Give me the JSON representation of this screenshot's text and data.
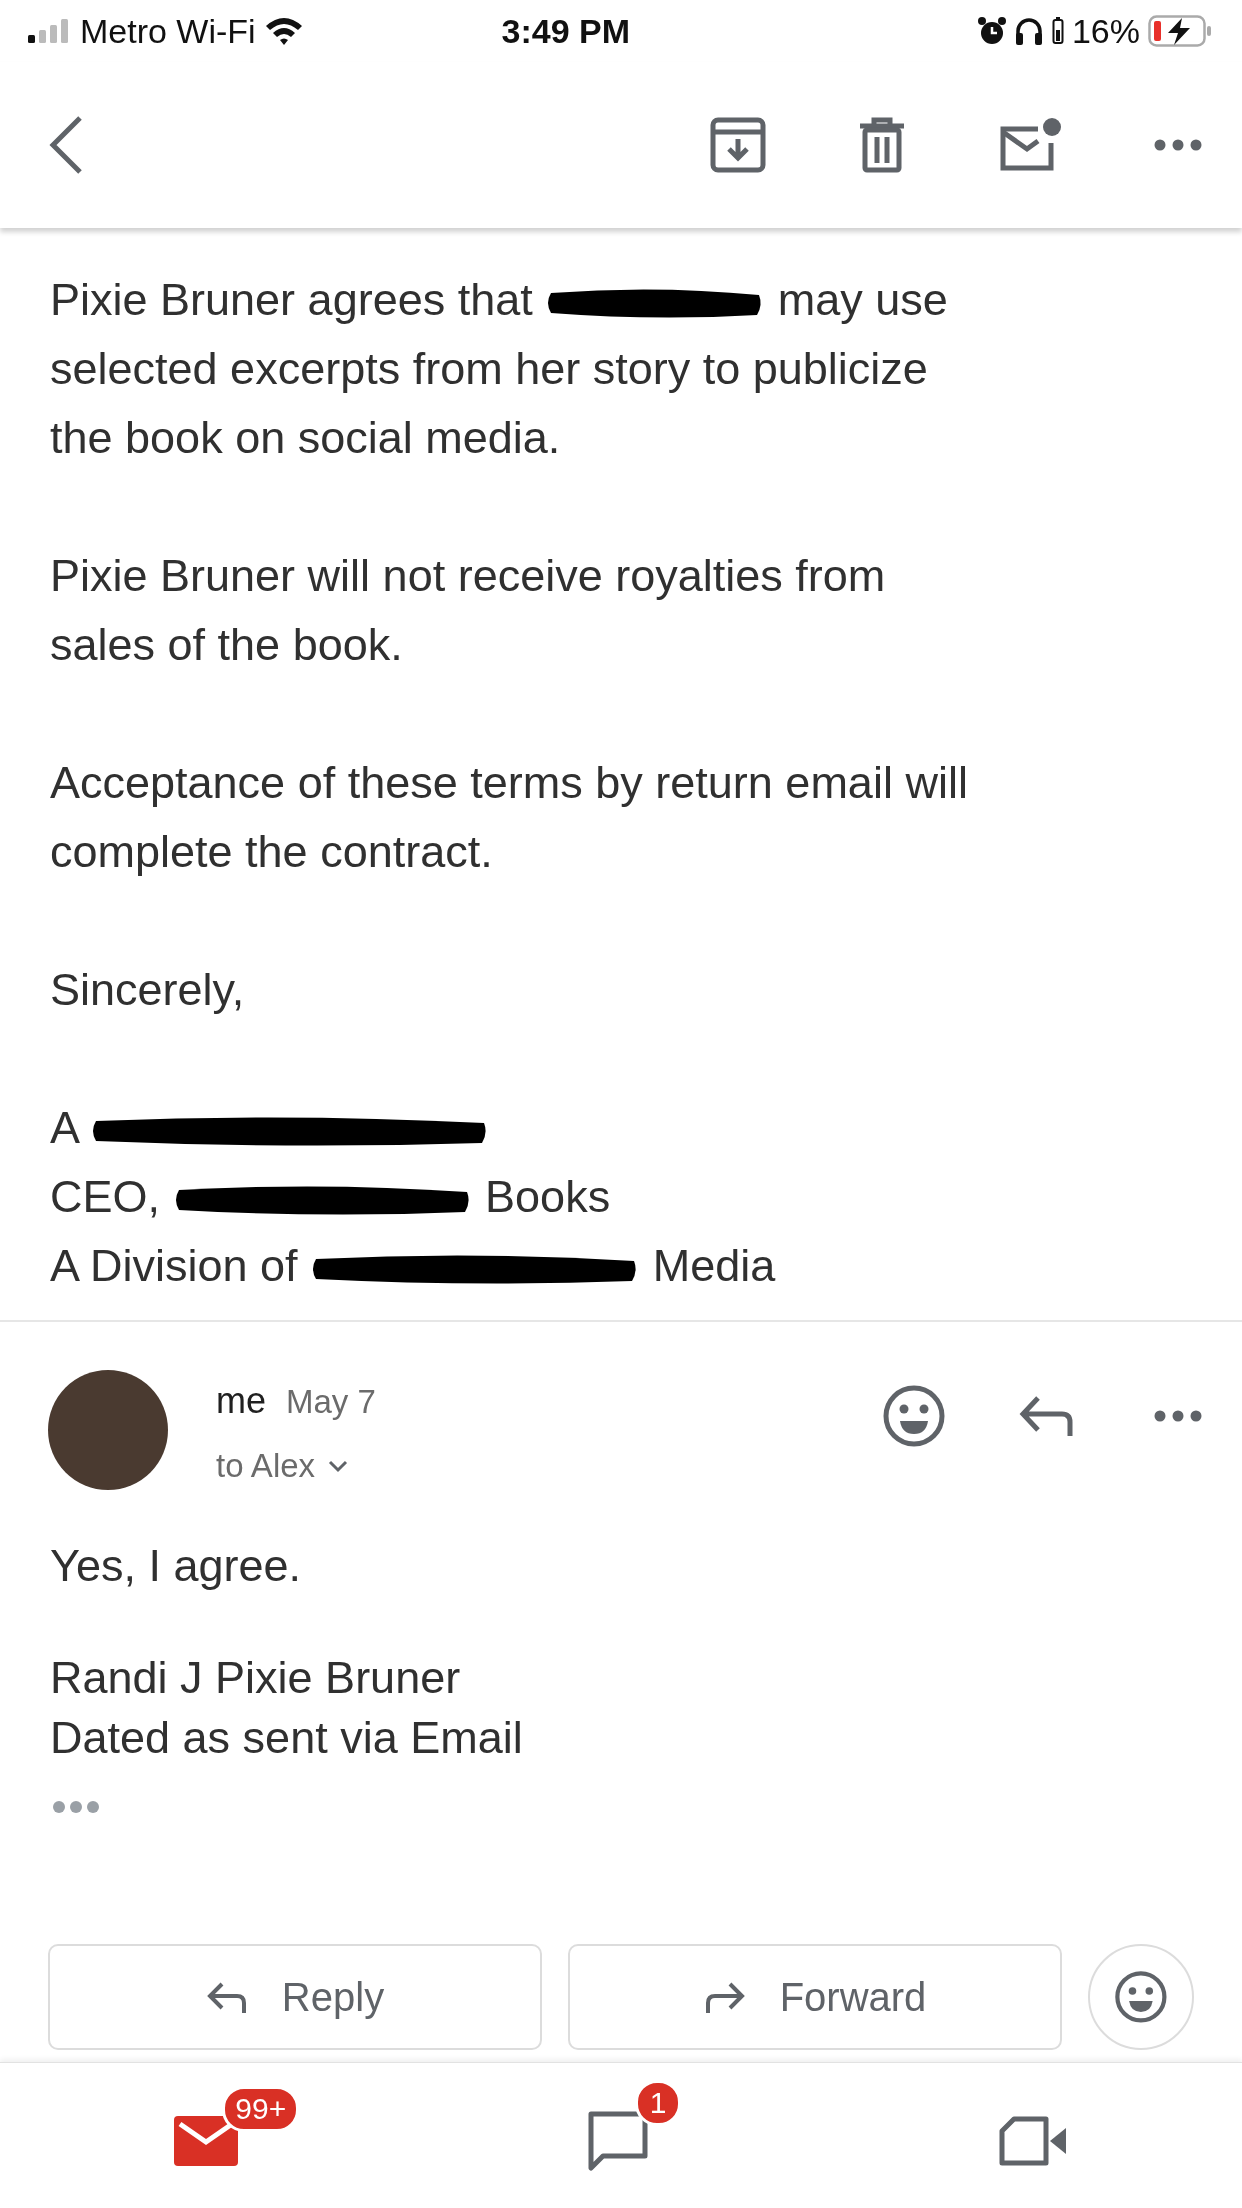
{
  "status_bar": {
    "carrier": "Metro Wi-Fi",
    "time": "3:49 PM",
    "battery_percent": "16%"
  },
  "message_body": [
    {
      "segments": [
        {
          "kind": "text",
          "text": "Pixie Bruner agrees that"
        },
        {
          "kind": "redaction"
        },
        {
          "kind": "text",
          "text": "may use"
        },
        {
          "kind": "break"
        },
        {
          "kind": "text",
          "text": "selected excerpts from her story to publicize\nthe book on social media."
        }
      ]
    },
    {
      "segments": [
        {
          "kind": "text",
          "text": "Pixie Bruner will not receive royalties from\nsales of the book."
        }
      ]
    },
    {
      "segments": [
        {
          "kind": "text",
          "text": "Acceptance of these terms by return email will\ncomplete the contract."
        }
      ]
    },
    {
      "segments": [
        {
          "kind": "text",
          "text": "Sincerely,"
        }
      ]
    },
    {
      "segments": [
        {
          "kind": "text",
          "text": "A"
        },
        {
          "kind": "redaction"
        },
        {
          "kind": "break"
        },
        {
          "kind": "text",
          "text": "CEO,"
        },
        {
          "kind": "redaction"
        },
        {
          "kind": "text",
          "text": "Books"
        },
        {
          "kind": "break"
        },
        {
          "kind": "text",
          "text": "A Division of"
        },
        {
          "kind": "redaction"
        },
        {
          "kind": "text",
          "text": "Media"
        }
      ]
    }
  ],
  "reply_message": {
    "sender": "me",
    "date": "May 7",
    "recipient": "to Alex",
    "body": [
      "Yes, I agree.",
      "Randi J Pixie Bruner\nDated as sent via Email"
    ]
  },
  "action_buttons": [
    {
      "label": "Reply",
      "kind": "reply"
    },
    {
      "label": "Forward",
      "kind": "forward"
    }
  ],
  "bottom_nav": [
    {
      "kind": "mail",
      "badge": "99+",
      "selected": true
    },
    {
      "kind": "chat",
      "badge": "1",
      "selected": false
    },
    {
      "kind": "video",
      "selected": false
    }
  ]
}
